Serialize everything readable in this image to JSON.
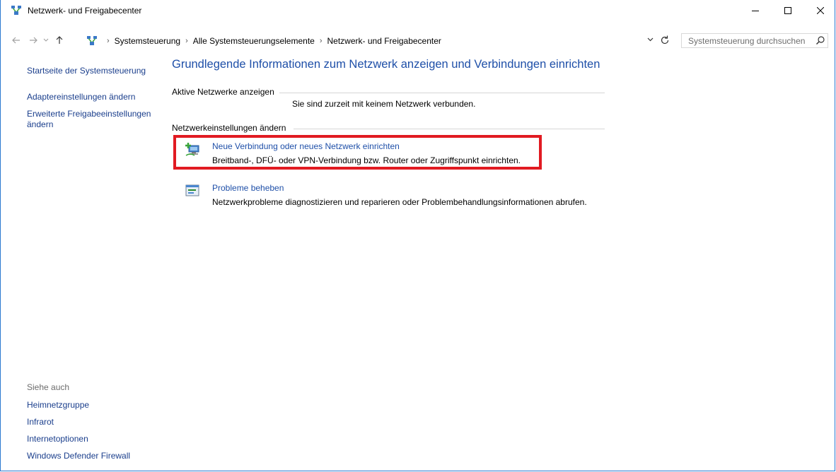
{
  "window": {
    "title": "Netzwerk- und Freigabecenter"
  },
  "navigation": {
    "breadcrumbs": [
      "Systemsteuerung",
      "Alle Systemsteuerungselemente",
      "Netzwerk- und Freigabecenter"
    ],
    "search_placeholder": "Systemsteuerung durchsuchen"
  },
  "left_pane": {
    "home_link": "Startseite der Systemsteuerung",
    "adapter_link": "Adaptereinstellungen ändern",
    "advanced_sharing_link": "Erweiterte Freigabeeinstellungen ändern",
    "see_also_heading": "Siehe auch",
    "see_also": [
      "Heimnetzgruppe",
      "Infrarot",
      "Internetoptionen",
      "Windows Defender Firewall"
    ]
  },
  "main": {
    "title": "Grundlegende Informationen zum Netzwerk anzeigen und Verbindungen einrichten",
    "active_networks_heading": "Aktive Netzwerke anzeigen",
    "no_network_text": "Sie sind zurzeit mit keinem Netzwerk verbunden.",
    "settings_heading": "Netzwerkeinstellungen ändern",
    "tasks": [
      {
        "link": "Neue Verbindung oder neues Netzwerk einrichten",
        "description": "Breitband-, DFÜ- oder VPN-Verbindung bzw. Router oder Zugriffspunkt einrichten."
      },
      {
        "link": "Probleme beheben",
        "description": "Netzwerkprobleme diagnostizieren und reparieren oder Problembehandlungsinformationen abrufen."
      }
    ]
  },
  "icons": {
    "app": "network-center-icon",
    "new_connection": "new-connection-icon",
    "troubleshoot": "troubleshoot-icon"
  },
  "colors": {
    "link": "#1e4fa8",
    "highlight": "#e11b22",
    "window_border": "#2b79d0"
  }
}
